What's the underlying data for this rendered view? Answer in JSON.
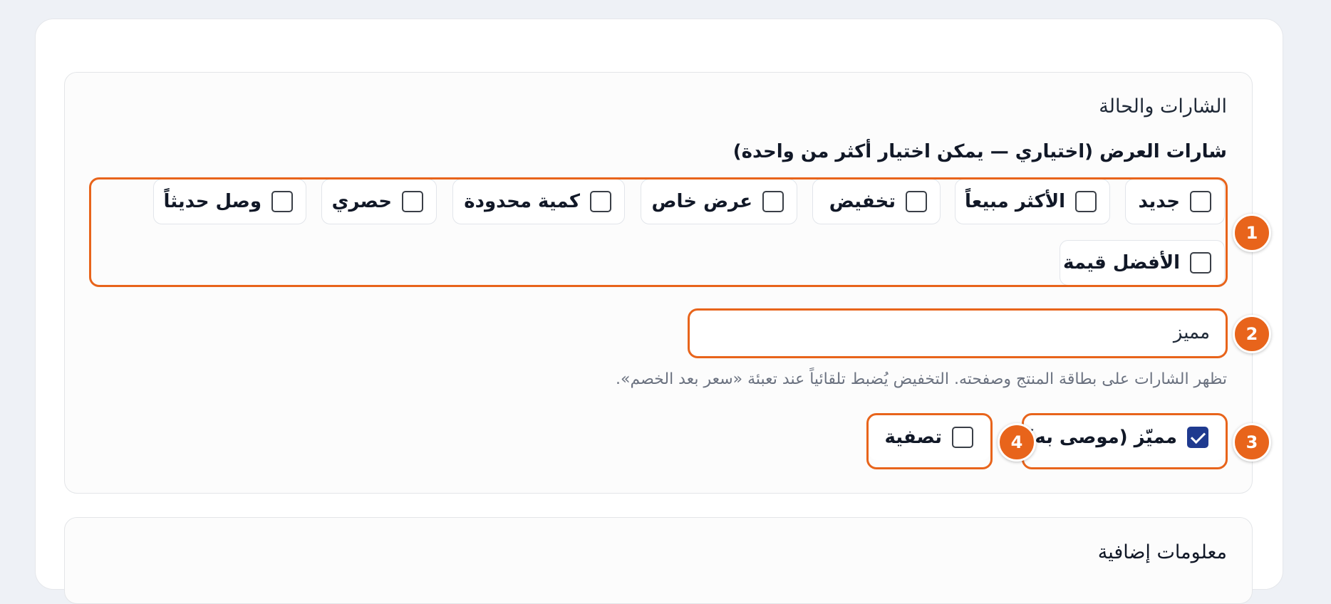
{
  "section": {
    "title": "الشارات والحالة",
    "badges_label": "شارات العرض (اختياري — يمكن اختيار أكثر من واحدة)",
    "badges": [
      {
        "label": "جديد",
        "checked": false
      },
      {
        "label": "الأكثر مبيعاً",
        "checked": false
      },
      {
        "label": "تخفيض",
        "checked": false
      },
      {
        "label": "عرض خاص",
        "checked": false
      },
      {
        "label": "كمية محدودة",
        "checked": false
      },
      {
        "label": "حصري",
        "checked": false
      },
      {
        "label": "وصل حديثاً",
        "checked": false
      },
      {
        "label": "الأفضل قيمة",
        "checked": false
      }
    ],
    "custom_badge_input": {
      "value": "مميز"
    },
    "help_text": "تظهر الشارات على بطاقة المنتج وصفحته. التخفيض يُضبط تلقائياً عند تعبئة «سعر بعد الخصم».",
    "featured": {
      "label": "مميّز (موصى به)",
      "checked": true
    },
    "clearance": {
      "label": "تصفية",
      "checked": false
    }
  },
  "annotations": [
    "1",
    "2",
    "3",
    "4"
  ],
  "section_2": {
    "title": "معلومات إضافية"
  },
  "colors": {
    "accent": "#e8641b",
    "checkbox_checked": "#1f3a8f",
    "background": "#eef1f6"
  }
}
